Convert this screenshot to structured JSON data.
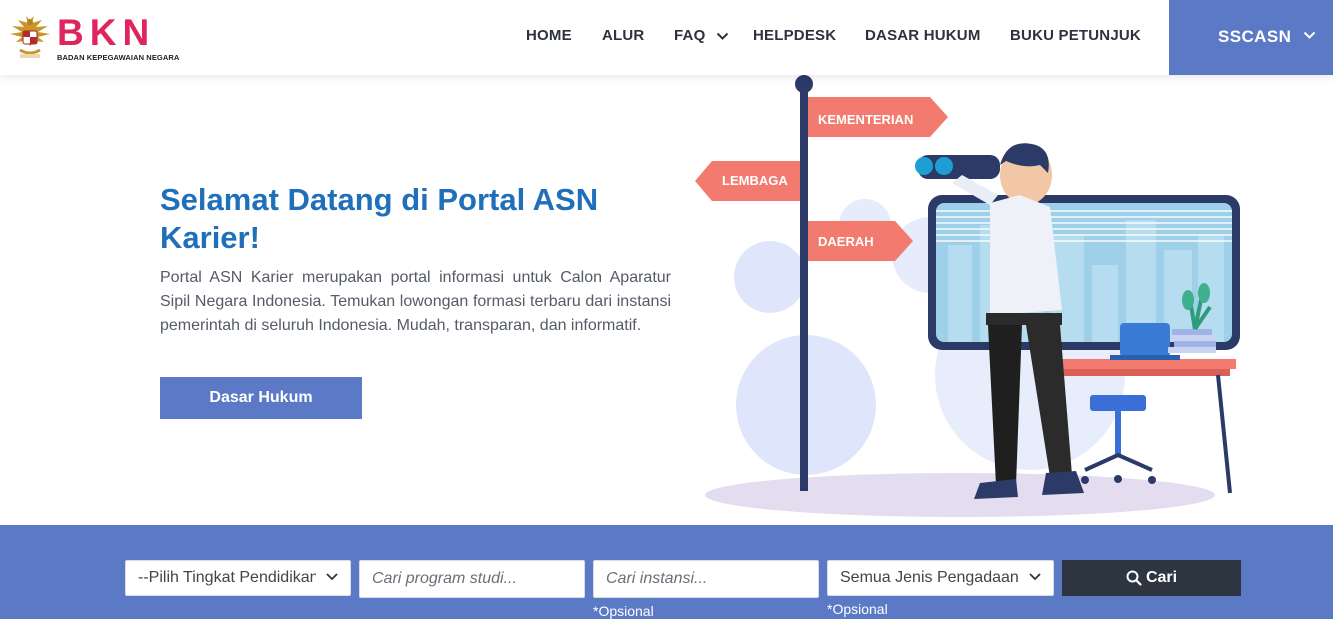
{
  "header": {
    "logo_text": "BKN",
    "logo_subtitle": "BADAN KEPEGAWAIAN NEGARA",
    "nav": [
      {
        "label": "HOME"
      },
      {
        "label": "ALUR"
      },
      {
        "label": "FAQ"
      },
      {
        "label": "HELPDESK"
      },
      {
        "label": "DASAR HUKUM"
      },
      {
        "label": "BUKU PETUNJUK"
      }
    ],
    "account_label": "SSCASN"
  },
  "hero": {
    "title": "Selamat Datang di Portal ASN Karier!",
    "description": "Portal ASN Karier merupakan portal informasi untuk Calon Aparatur Sipil Negara Indonesia. Temukan lowongan formasi terbaru dari instansi pemerintah di seluruh Indonesia. Mudah, transparan, dan informatif.",
    "button_label": "Dasar Hukum",
    "signposts": [
      "KEMENTERIAN",
      "LEMBAGA",
      "DAERAH"
    ]
  },
  "search": {
    "education_select": "--Pilih Tingkat Pendidikan--",
    "program_placeholder": "Cari program studi...",
    "agency_placeholder": "Cari instansi...",
    "procurement_select": "Semua Jenis Pengadaan",
    "optional_note": "*Opsional",
    "button_label": "Cari"
  },
  "colors": {
    "primary": "#5b79c5",
    "title": "#1f6fba",
    "dark_button": "#2c3540",
    "signpost": "#f47a6e"
  },
  "icons": [
    "garuda-emblem-icon",
    "chevron-down-icon",
    "search-icon"
  ]
}
